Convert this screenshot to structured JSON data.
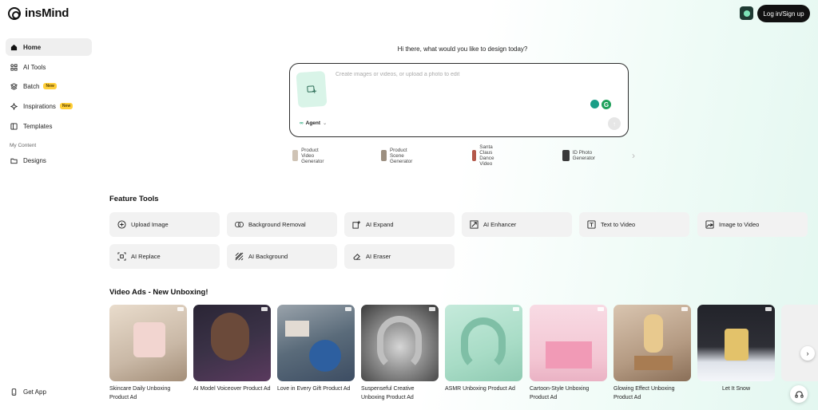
{
  "header": {
    "brand": "insMind",
    "login_label": "Log in/Sign up",
    "gift_icon": "gift-icon"
  },
  "sidebar": {
    "items": [
      {
        "label": "Home",
        "icon": "home-icon",
        "active": true
      },
      {
        "label": "AI Tools",
        "icon": "tools-grid-icon"
      },
      {
        "label": "Batch",
        "icon": "layers-icon",
        "badge": "New"
      },
      {
        "label": "Inspirations",
        "icon": "sparkle-icon",
        "badge": "New"
      },
      {
        "label": "Templates",
        "icon": "template-icon"
      }
    ],
    "section_label": "My Content",
    "designs_label": "Designs",
    "get_app_label": "Get App"
  },
  "main": {
    "greeting": "Hi there, what would you like to design today?",
    "prompt_placeholder": "Create images or videos, or upload a photo to edit",
    "agent_label": "Agent",
    "suggestions": [
      {
        "label": "Product Video Generator"
      },
      {
        "label": "Product Scene Generator"
      },
      {
        "label": "Santa Claus Dance Video"
      },
      {
        "label": "ID Photo Generator"
      }
    ],
    "feature_title": "Feature Tools",
    "tools": [
      {
        "label": "Upload Image",
        "icon": "plus-circle-icon"
      },
      {
        "label": "Background Removal",
        "icon": "bg-removal-icon"
      },
      {
        "label": "AI Expand",
        "icon": "expand-icon"
      },
      {
        "label": "AI Enhancer",
        "icon": "enhance-icon"
      },
      {
        "label": "Text to Video",
        "icon": "text-video-icon"
      },
      {
        "label": "Image to Video",
        "icon": "image-video-icon"
      },
      {
        "label": "AI Replace",
        "icon": "replace-icon"
      },
      {
        "label": "AI Background",
        "icon": "pattern-icon"
      },
      {
        "label": "AI Eraser",
        "icon": "eraser-icon"
      }
    ],
    "video_title": "Video Ads - New Unboxing!",
    "videos": [
      {
        "title": "Skincare Daily Unboxing Product Ad",
        "color": "#c9b8a6"
      },
      {
        "title": "AI Model Voiceover Product Ad",
        "color": "#3b3247"
      },
      {
        "title": "Love in Every Gift Product Ad",
        "color": "#5a6b7a"
      },
      {
        "title": "Suspenseful Creative Unboxing Product Ad",
        "color": "#8d8d8d"
      },
      {
        "title": "ASMR Unboxing Product Ad",
        "color": "#a8dcc6"
      },
      {
        "title": "Cartoon-Style Unboxing Product Ad",
        "color": "#f3c6d3"
      },
      {
        "title": "Glowing Effect Unboxing Product Ad",
        "color": "#b49a82"
      },
      {
        "title": "Let It Snow",
        "color": "#2e2f36"
      }
    ]
  },
  "colors": {
    "accent": "#2aa97c",
    "dark": "#111111",
    "tool_bg": "#f2f2f2",
    "badge": "#ffcf3a"
  }
}
